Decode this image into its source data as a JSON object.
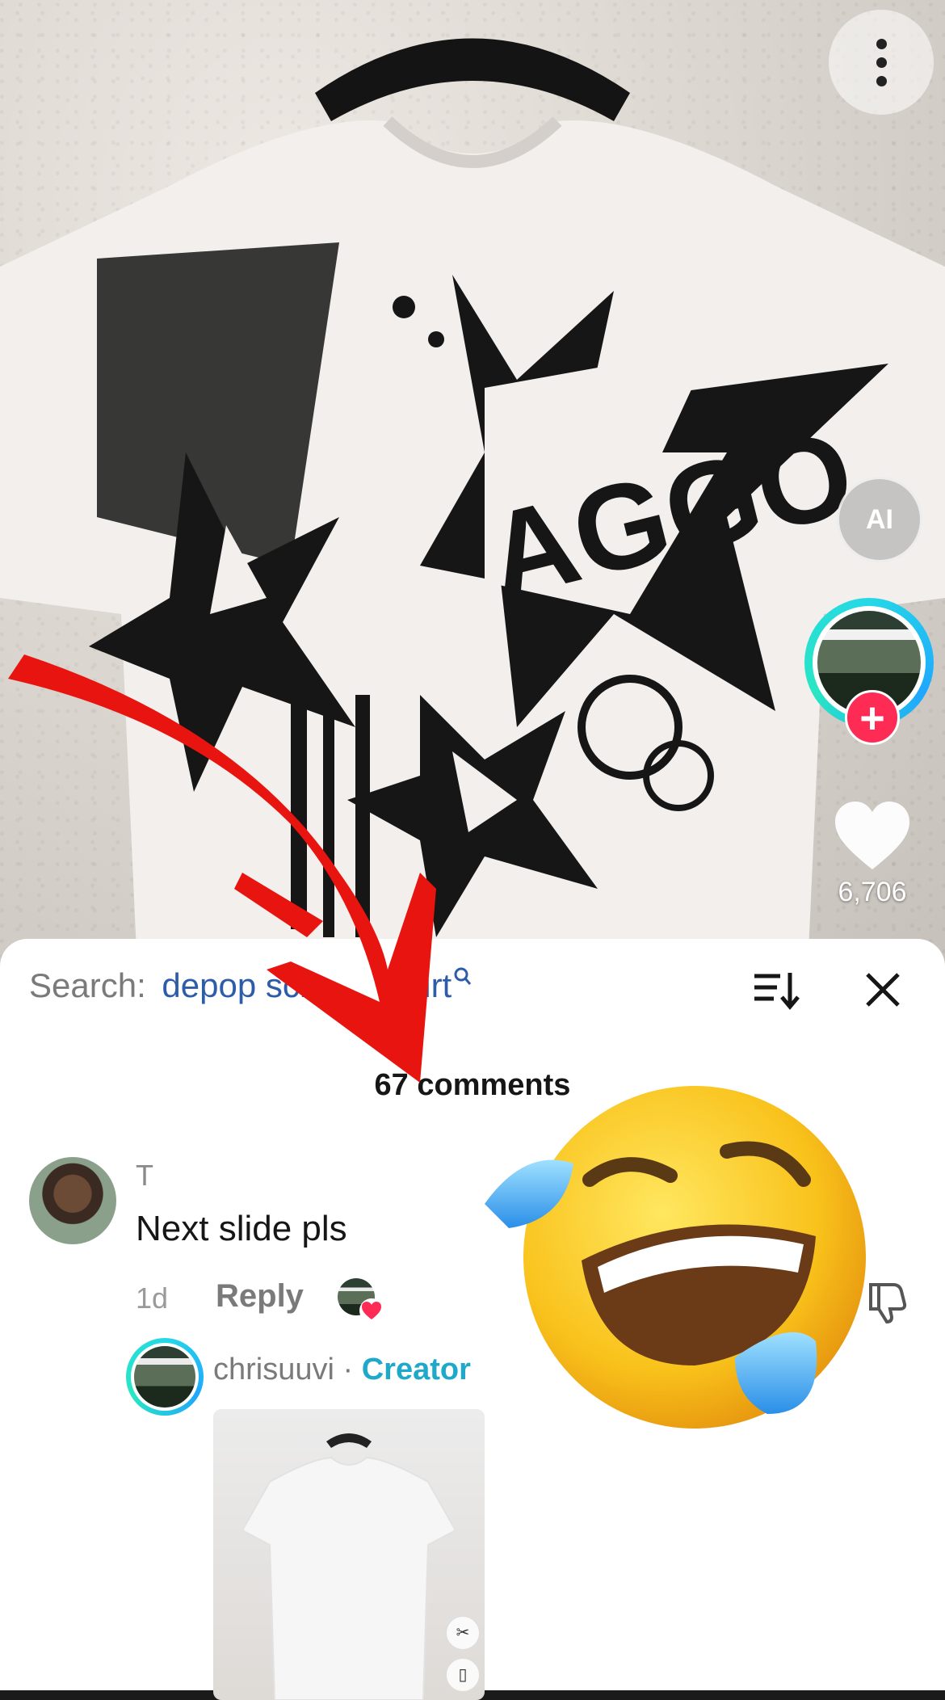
{
  "video": {
    "like_count": "6,706"
  },
  "icons": {
    "menu": "more-vertical-icon",
    "ai": "ai-icon",
    "follow": "plus-icon",
    "like": "heart-icon",
    "sort": "sort-icon",
    "close": "close-icon",
    "search": "search-icon",
    "dislike": "dislike-icon"
  },
  "ai_label": "AI",
  "follow_label": "+",
  "comments_sheet": {
    "search_label": "Search:",
    "search_query": "depop scr",
    "search_query_tail": "shirt",
    "count_label": "67 comments",
    "comment": {
      "username": "T",
      "text": "Next slide pls",
      "time": "1d",
      "reply_label": "Reply"
    },
    "reply": {
      "username": "chrisuuvi",
      "separator": "·",
      "badge": "Creator"
    }
  },
  "colors": {
    "accent_red": "#fe2c55",
    "link_blue": "#2d5ca8",
    "creator_teal": "#1ea8c9",
    "overlay_arrow": "#e8140f"
  }
}
